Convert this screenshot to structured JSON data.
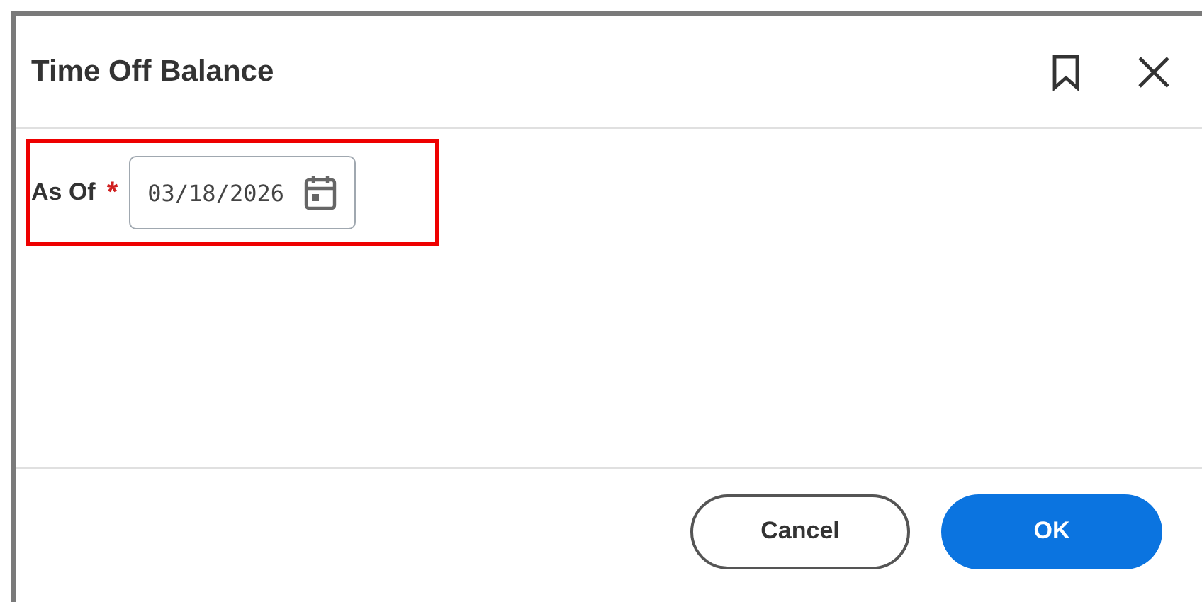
{
  "dialog": {
    "title": "Time Off Balance"
  },
  "field": {
    "label": "As Of",
    "required_mark": "*",
    "value": "03/18/2026",
    "highlighted": true
  },
  "buttons": [
    {
      "label": "Cancel",
      "kind": "secondary"
    },
    {
      "label": "OK",
      "kind": "primary"
    }
  ]
}
